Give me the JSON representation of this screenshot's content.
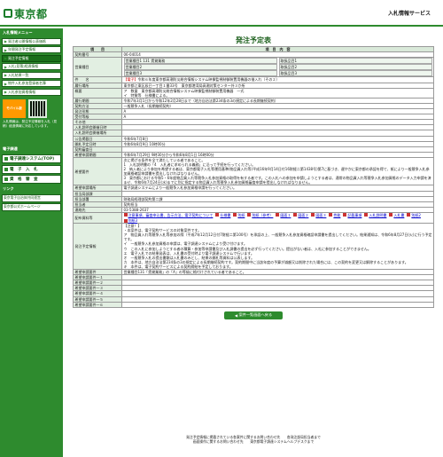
{
  "header": {
    "logo_text": "東京都",
    "system_title": "入札情報サービス"
  },
  "sidebar": {
    "heading1": "入札情報メニュー",
    "nav_items": [
      "発注者公開情報公表価格",
      "年間発注予定情報",
      "発注予定情報",
      "入札(見積)経過情報",
      "入札結果一覧",
      "物件入札参加登録者名簿",
      "入札参加資格情報"
    ],
    "mobile_label": "モバイル版",
    "mobile_text": "入札情報は、発注予定情報を入札（見積）経過情報に対応しています。",
    "heading2": "電子調達",
    "menu_items": [
      "電子調達システム(TOP)",
      "電　子　入　札",
      "資　格　審　査"
    ],
    "heading3": "リンク",
    "links": [
      "東京電子自治体共同運営",
      "東京都公式ホームページ"
    ]
  },
  "main": {
    "title": "発注予定表",
    "header_col1": "項　　目",
    "header_col2": "項　目　内　容",
    "back_button": "案件一覧画面へ戻る"
  },
  "rows": {
    "keiyaku_no_label": "契約番号",
    "keiyaku_no": "06-04014",
    "eigyo_label": "営業種目",
    "eigyo_items": [
      "営業種目1 131 賃貸業務",
      "営業種目2",
      "営業種目3"
    ],
    "eigyo_detail": [
      "取扱品目1",
      "取扱品目2",
      "取扱品目3"
    ],
    "kenmei_label": "件　　名",
    "kenmei_tag": "【電子】",
    "kenmei": "令和６年度東京都高潮防災総合情報システム映像監視制御装置用機器の借入れ（その２）",
    "basho_label": "履行場所",
    "basho": "東京都江東区辰巳一丁目１番33号　東京都港湾局高潮対策センター外３か所",
    "gaiyo_label": "概要",
    "gaiyo": [
      "ア　数量　東京都高潮防災総合情報システム映像監視制御装置用機器　一式",
      "イ　特質等　仕様書による。"
    ],
    "kikan_label": "履行期間",
    "kikan": "令和7年3月1日から令和12年2月28日まで（地方自治法第234条の3の規定による長期継続契約）",
    "hoho_label": "契約方法",
    "hoho": "一般競争入札（長期継続契約）",
    "keitai_label": "発注形態",
    "keitai": "A",
    "uketsuke_label": "受付等級",
    "uketsuke": "A",
    "sonota_label": "その他",
    "sonota": "",
    "setsumei_label": "入札説明会開催日時",
    "setsumei": "",
    "setsumei_basho_label": "入札説明会開催場所",
    "setsumei_basho": "",
    "koukai_label": "公告掲載日",
    "koukai": "令和6年7月8日",
    "kaisatsu_label": "開札予定日時",
    "kaisatsu": "令和6年8月9日 10時00分",
    "yosan_label": "契約審査日",
    "yosan": "",
    "shinsei_label": "希望申請期間",
    "shinsei": "令和6年7月29日 9時30分から令和6年8月1日 16時00分",
    "kibou_label": "希望要件",
    "kibou": [
      "次に掲げる条件を全て満たしている者であること。",
      "1　入札説明書の「4　入札者に求められる義務」に沿って手続を行ってください。",
      "2　納入者により参加を希望する者は、東京都電子入札等運用基準(物品買入れ等)平成16年9月14日付16財経二第1438号)第7に基づき、遅やかに東京都の承認を得て、紙により一般競争入札参加資格確認申請書を提出しなければなりません。",
      "3　東京都における令和5・6年度物品買入れ等競争入札参加資格の取得を有する者です。この入札への参加を申請しようとする者は、通常の物品買入れ等競争入札参加資格のデータ入力申請を済ませ、令和6年7月24日(水)までに別に指定する物品買入れ等競争入札参加資格審査申請を提出しなければなりません。"
    ],
    "shinsei_hoho_label": "希望申請場所",
    "shinsei_hoho": "電子調達システムにより一般競争入札参加資格申請を行ってください。",
    "tanto_label": "担当局部課",
    "tanto": "",
    "tanto_busho_label": "担当部署",
    "tanto_busho": "財務局経理部契約第二課",
    "hokan_label": "担当者",
    "hokan": "契約担当",
    "renraku_label": "連絡先",
    "renraku": "03-5388-2637",
    "docs_label": "配布資料等",
    "docs": [
      "注意事項、審査申込書、告示方法、電子契約について",
      "仕様書",
      "別紙",
      "別紙（参考）",
      "図面１",
      "図面２",
      "図面３",
      "性能",
      "記載事項",
      "入札説明書",
      "入札書",
      "別紙2",
      "別紙3"
    ],
    "yotei_label": "発注予定情報",
    "yotei": [
      "【注意！】",
      "・本案件は、電子契約サービスの対象案件です。",
      "ア　物品買入れ等競争入札等参加の際（平成7年12月12日付7財経二第100号）を承認の上、一般競争入札参加資格確認申請書を提出してください。結果通知は、令和6年8月27日(火)に行う予定です。",
      "イ　一般競争入札参加資格の申請は、電子調達システムにより受け付けます。",
      "ウ　この入札に参加しようとする者の積算・参加等申請書及び入札調書の提出を必ず行ってください。提出がない者は、入札に参加することができません。",
      "エ　電子入札での結果発表は、入札書の受付時より電子調達システムで行います。",
      "オ　一般競争入札の提出書類は入札書のみとし、結果の開札等資料は公表します。",
      "カ　本件は、地方自治法第234条の3の規定による長期継続契約です。契約期間中に当該年度の予算が減額又は削除された場合には、この契約を変更又は解除することがあります。",
      "キ　本件は、電子契約サービスによる契約締結を予定しております。"
    ],
    "mokuhyo_label": "希望申請要件",
    "mokuhyo": "営業種目131「賃貸業務」の「A」の等級に格付けされている者であること。",
    "kibou_items_label": [
      "希望申請要件一１",
      "希望申請要件一２",
      "希望申請要件一３",
      "希望申請要件一４",
      "希望申請要件一５",
      "希望申請要件一６"
    ],
    "kibou_items": [
      "",
      "",
      "",
      "",
      "",
      ""
    ]
  },
  "footer": {
    "line1": "発注予定情報に掲載されている各案件に関するお問い合わせ先　　各発注部局担当者まで",
    "line2": "画面操作に関するお問い合わせ先　　東京都電子調達システムヘルプデスクまで"
  },
  "colors": {
    "brand_green": "#2e8b2e",
    "label_bg": "#e2efe2"
  }
}
